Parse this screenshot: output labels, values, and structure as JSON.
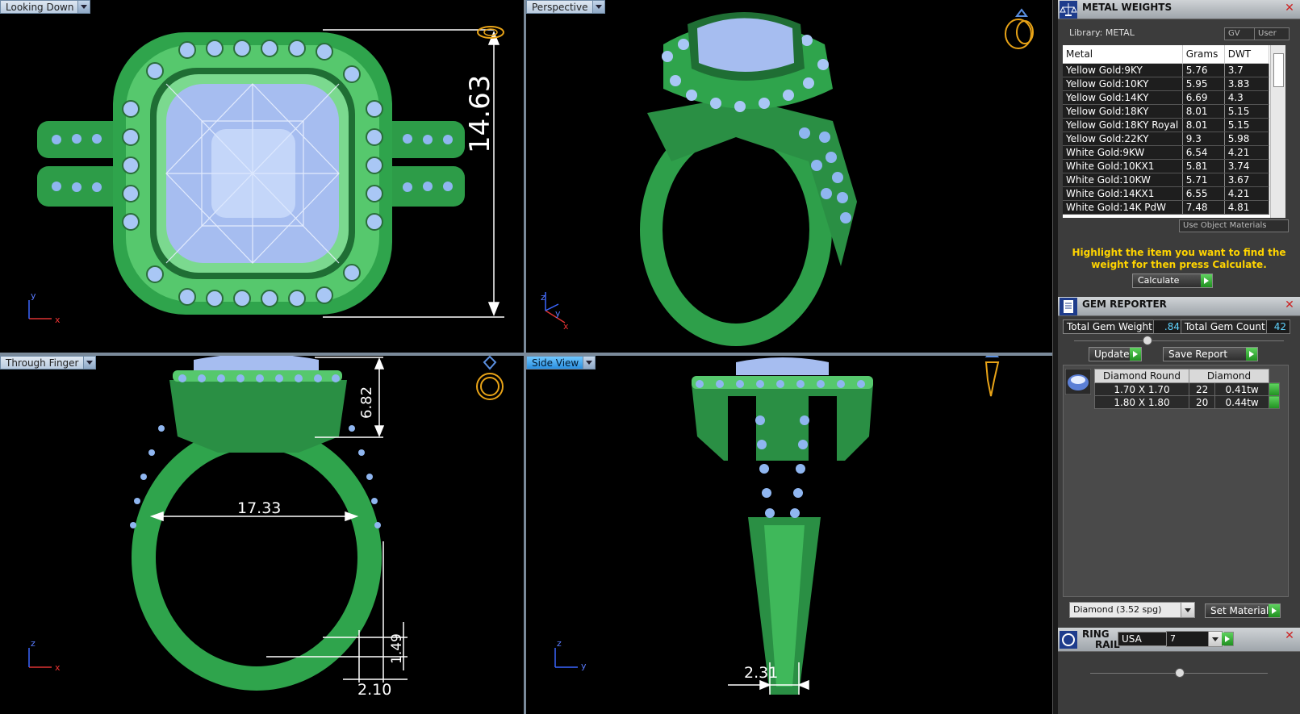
{
  "viewports": {
    "top_left": {
      "label": "Looking Down",
      "dimension": "14.63"
    },
    "top_right": {
      "label": "Perspective"
    },
    "bottom_left": {
      "label": "Through Finger",
      "dim_height": "6.82",
      "dim_width": "17.33",
      "dim_band_thick": "1.49",
      "dim_band_width": "2.10"
    },
    "bottom_right": {
      "label": "Side View",
      "dim_shank": "2.31"
    },
    "axis": {
      "x": "x",
      "y": "y",
      "z": "z"
    }
  },
  "metal_weights": {
    "title": "METAL WEIGHTS",
    "library_label": "Library: METAL",
    "gv_label": "GV",
    "user_label": "User",
    "columns": [
      "Metal",
      "Grams",
      "DWT"
    ],
    "rows": [
      [
        "Yellow Gold:9KY",
        "5.76",
        "3.7"
      ],
      [
        "Yellow Gold:10KY",
        "5.95",
        "3.83"
      ],
      [
        "Yellow Gold:14KY",
        "6.69",
        "4.3"
      ],
      [
        "Yellow Gold:18KY",
        "8.01",
        "5.15"
      ],
      [
        "Yellow Gold:18KY Royal",
        "8.01",
        "5.15"
      ],
      [
        "Yellow Gold:22KY",
        "9.3",
        "5.98"
      ],
      [
        "White Gold:9KW",
        "6.54",
        "4.21"
      ],
      [
        "White Gold:10KX1",
        "5.81",
        "3.74"
      ],
      [
        "White Gold:10KW",
        "5.71",
        "3.67"
      ],
      [
        "White Gold:14KX1",
        "6.55",
        "4.21"
      ],
      [
        "White Gold:14K PdW",
        "7.48",
        "4.81"
      ]
    ],
    "use_object_materials": "Use Object Materials",
    "hint": "Highlight the item you want to find the weight for then press Calculate.",
    "calculate_label": "Calculate"
  },
  "gem_reporter": {
    "title": "GEM REPORTER",
    "total_weight_label": "Total Gem Weight",
    "total_weight_value": ".84",
    "total_count_label": "Total Gem Count",
    "total_count_value": "42",
    "update_label": "Update",
    "save_report_label": "Save Report",
    "table_headers": [
      "Diamond Round",
      "Diamond"
    ],
    "rows": [
      [
        "1.70 X 1.70",
        "22",
        "0.41tw"
      ],
      [
        "1.80 X 1.80",
        "20",
        "0.44tw"
      ]
    ],
    "material_select": "Diamond    (3.52 spg)",
    "set_material_label": "Set Material"
  },
  "ring_rail": {
    "title_line1": "RING",
    "title_line2": "RAIL",
    "standard": "USA",
    "size": "7"
  },
  "colors": {
    "metal_green": "#3fb85a",
    "gem_blue": "#8fb6f0",
    "accent_yellow": "#ffd400",
    "accent_blue": "#2a8fe0"
  }
}
